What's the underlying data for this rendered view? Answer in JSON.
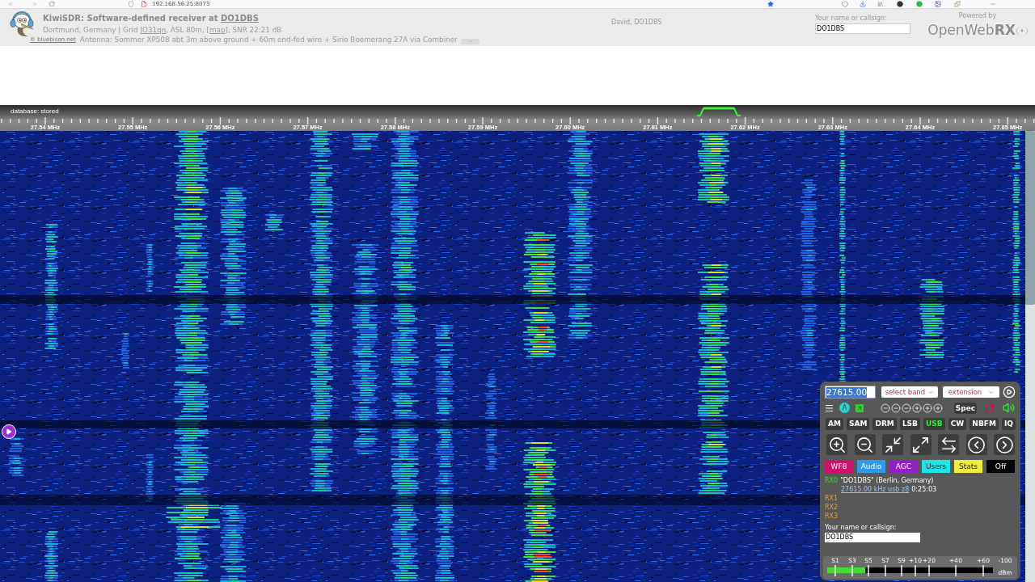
{
  "browser": {
    "url": "192.168.56.25:8073"
  },
  "header": {
    "title": {
      "text": "KiwiSDR: Software-defined receiver at",
      "link": "DO1DBS"
    },
    "location": [
      {
        "kind": "text",
        "text": "Dortmund, Germany | Grid "
      },
      {
        "kind": "link",
        "text": "JO31qn"
      },
      {
        "kind": "text",
        "text": ", ASL 80m, ["
      },
      {
        "kind": "link",
        "text": "map"
      },
      {
        "kind": "text",
        "text": "], SNR 22:21 dB"
      }
    ],
    "credit": "© bluebison.net",
    "antenna": "Antenna: Sommer XP508 abt 3m above ground + 60m end-fed wire + Sirio Boomerang 27A via Combiner",
    "owner": "David, DO1DBS",
    "callsign": {
      "label": "Your name or callsign:",
      "value": "DO1DBS"
    },
    "powered": {
      "label": "Powered by",
      "logo": "OpenWeb**RX**"
    }
  },
  "scale": {
    "status": "database: stored",
    "labels": [
      "27.54 MHz",
      "27.55 MHz",
      "27.56 MHz",
      "27.57 MHz",
      "27.58 MHz",
      "27.59 MHz",
      "27.60 MHz",
      "27.61 MHz",
      "27.62 MHz",
      "27.63 MHz",
      "27.64 MHz",
      "27.65 MHz"
    ]
  },
  "panel": {
    "frequency": "27615.00",
    "band_select": "select band",
    "extension_select": "extension",
    "letter_button": "A",
    "spec_button": "Spec",
    "modes": [
      {
        "label": "AM",
        "selected": false
      },
      {
        "label": "SAM",
        "selected": false
      },
      {
        "label": "DRM",
        "selected": false
      },
      {
        "label": "LSB",
        "selected": false
      },
      {
        "label": "USB",
        "selected": true
      },
      {
        "label": "CW",
        "selected": false
      },
      {
        "label": "NBFM",
        "selected": false
      },
      {
        "label": "IQ",
        "selected": false
      }
    ],
    "toggles": [
      {
        "label": "WF8",
        "color": "#d0106a"
      },
      {
        "label": "Audio",
        "color": "#3399e6"
      },
      {
        "label": "AGC",
        "color": "#9020c4"
      },
      {
        "label": "Users",
        "color": "#22e4e4"
      },
      {
        "label": "Stats",
        "color": "#f0ec40"
      },
      {
        "label": "Off",
        "color": "#000000"
      }
    ],
    "users": [
      {
        "label": "RX0",
        "active": true,
        "name": "\"DO1DBS\" (Berlin, Germany)",
        "link": "27615.00 kHz usb z8",
        "time": "0:25:03"
      },
      {
        "label": "RX1",
        "active": false
      },
      {
        "label": "RX2",
        "active": false
      },
      {
        "label": "RX3",
        "active": false
      }
    ],
    "callsign": {
      "label": "Your name or callsign:",
      "value": "DO1DBS"
    },
    "smeter": {
      "labels": [
        "S1",
        "S3",
        "S5",
        "S7",
        "S9",
        "+10",
        "+20",
        "+40",
        "+60",
        "-100"
      ],
      "unit": "dBm",
      "level": 0.23
    }
  }
}
